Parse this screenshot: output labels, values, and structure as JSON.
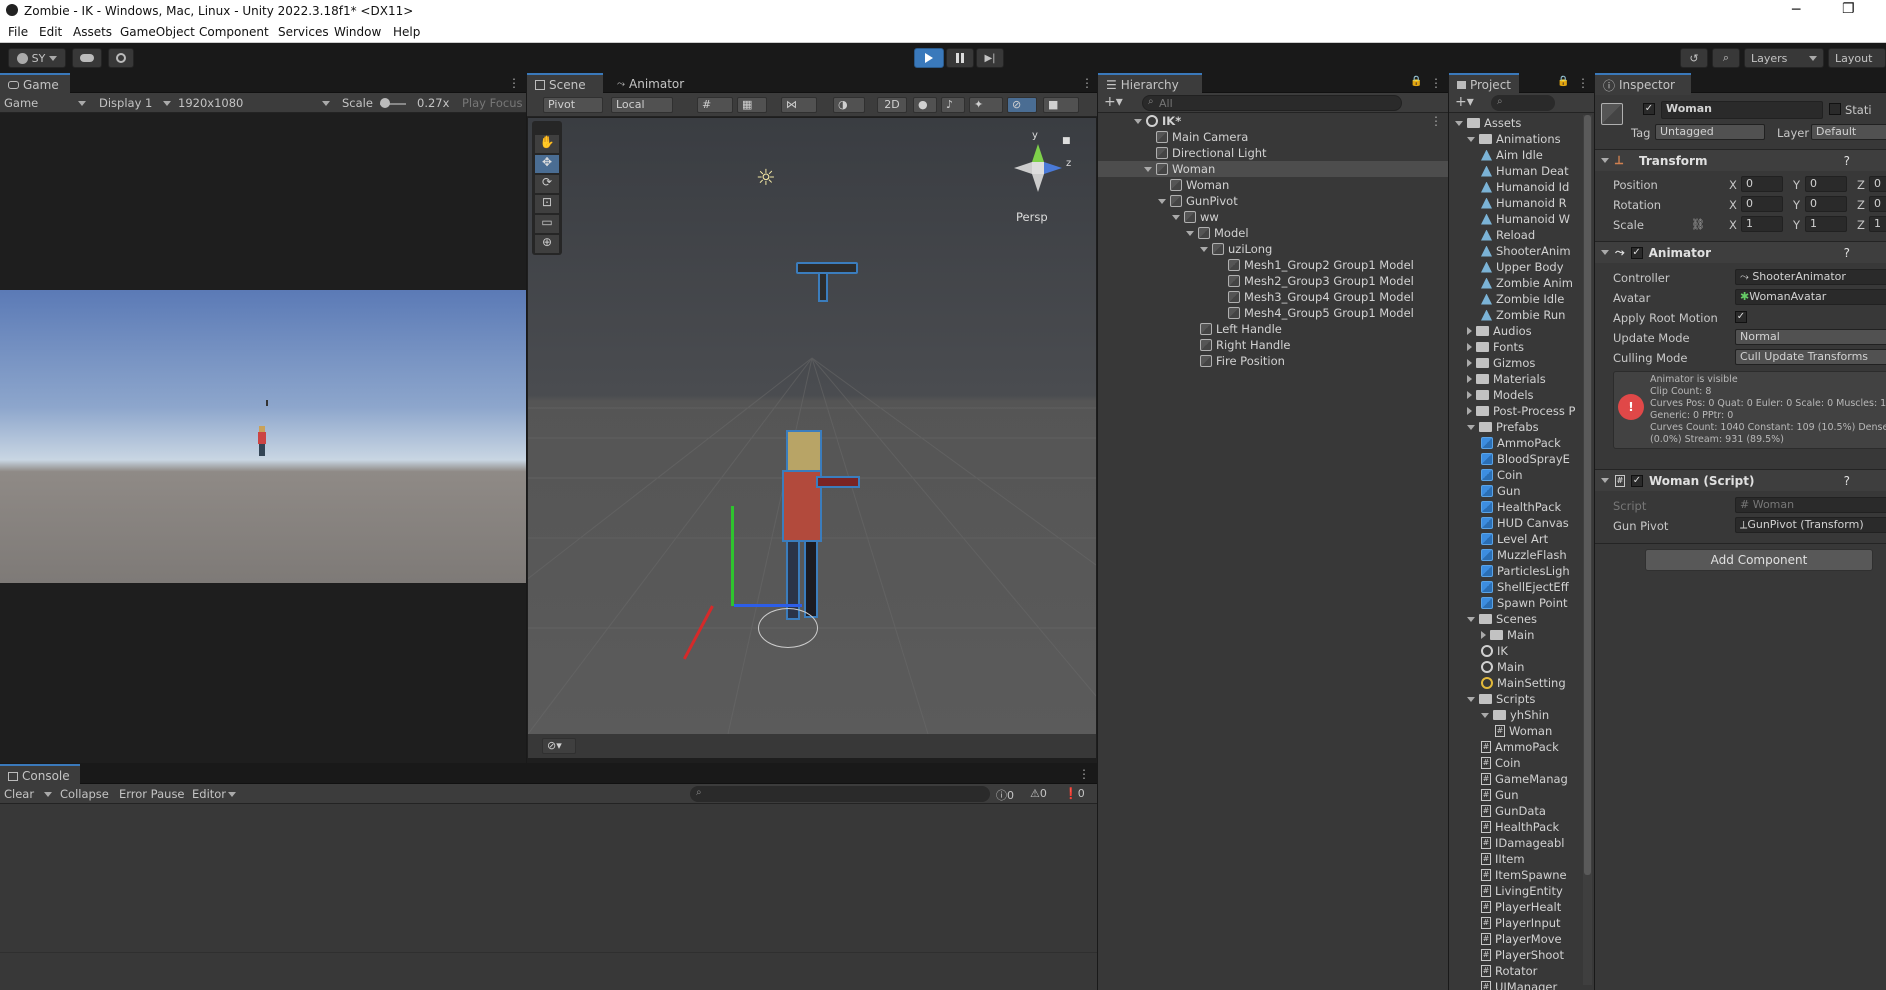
{
  "window": {
    "title": "Zombie - IK - Windows, Mac, Linux - Unity 2022.3.18f1* <DX11>"
  },
  "menu": [
    "File",
    "Edit",
    "Assets",
    "GameObject",
    "Component",
    "Services",
    "Window",
    "Help"
  ],
  "toolbar": {
    "account": "SY",
    "layers": "Layers",
    "layout": "Layout"
  },
  "game": {
    "tab": "Game",
    "mode": "Game",
    "display": "Display 1",
    "resolution": "1920x1080",
    "scale_label": "Scale",
    "scale_value": "0.27x",
    "play_focus": "Play Focus"
  },
  "scene": {
    "tab_scene": "Scene",
    "tab_animator": "Animator",
    "pivot": "Pivot",
    "local": "Local",
    "mode_2d": "2D",
    "persp": "Persp",
    "gizmo_y": "y",
    "gizmo_z": "z"
  },
  "hierarchy": {
    "tab": "Hierarchy",
    "search_placeholder": "All",
    "items": [
      {
        "label": "IK*",
        "bold": true
      },
      {
        "label": "Main Camera"
      },
      {
        "label": "Directional Light"
      },
      {
        "label": "Woman"
      },
      {
        "label": "Woman"
      },
      {
        "label": "GunPivot"
      },
      {
        "label": "ww"
      },
      {
        "label": "Model"
      },
      {
        "label": "uziLong"
      },
      {
        "label": "Mesh1_Group2 Group1 Model"
      },
      {
        "label": "Mesh2_Group3 Group1 Model"
      },
      {
        "label": "Mesh3_Group4 Group1 Model"
      },
      {
        "label": "Mesh4_Group5 Group1 Model"
      },
      {
        "label": "Left Handle"
      },
      {
        "label": "Right Handle"
      },
      {
        "label": "Fire Position"
      }
    ]
  },
  "project": {
    "tab": "Project",
    "items": [
      {
        "label": "Assets",
        "icon": "folder-icon"
      },
      {
        "label": "Animations",
        "icon": "folder-icon"
      },
      {
        "label": "Aim Idle",
        "icon": "animation-icon"
      },
      {
        "label": "Human Deat",
        "icon": "animation-icon"
      },
      {
        "label": "Humanoid Id",
        "icon": "animation-icon"
      },
      {
        "label": "Humanoid R",
        "icon": "animation-icon"
      },
      {
        "label": "Humanoid W",
        "icon": "animation-icon"
      },
      {
        "label": "Reload",
        "icon": "animation-icon"
      },
      {
        "label": "ShooterAnim",
        "icon": "animator-icon"
      },
      {
        "label": "Upper Body",
        "icon": "animation-icon"
      },
      {
        "label": "Zombie Anim",
        "icon": "animator-icon"
      },
      {
        "label": "Zombie Idle",
        "icon": "animation-icon"
      },
      {
        "label": "Zombie Run",
        "icon": "animation-icon"
      },
      {
        "label": "Audios",
        "icon": "folder-icon"
      },
      {
        "label": "Fonts",
        "icon": "folder-icon"
      },
      {
        "label": "Gizmos",
        "icon": "folder-icon"
      },
      {
        "label": "Materials",
        "icon": "folder-icon"
      },
      {
        "label": "Models",
        "icon": "folder-icon"
      },
      {
        "label": "Post-Process P",
        "icon": "folder-icon"
      },
      {
        "label": "Prefabs",
        "icon": "folder-icon"
      },
      {
        "label": "AmmoPack",
        "icon": "prefab-icon"
      },
      {
        "label": "BloodSprayE",
        "icon": "prefab-icon"
      },
      {
        "label": "Coin",
        "icon": "prefab-icon"
      },
      {
        "label": "Gun",
        "icon": "prefab-icon"
      },
      {
        "label": "HealthPack",
        "icon": "prefab-icon"
      },
      {
        "label": "HUD Canvas",
        "icon": "prefab-icon"
      },
      {
        "label": "Level Art",
        "icon": "prefab-icon"
      },
      {
        "label": "MuzzleFlash",
        "icon": "prefab-icon"
      },
      {
        "label": "ParticlesLigh",
        "icon": "prefab-icon"
      },
      {
        "label": "ShellEjectEff",
        "icon": "prefab-icon"
      },
      {
        "label": "Spawn Point",
        "icon": "prefab-icon"
      },
      {
        "label": "Scenes",
        "icon": "folder-icon"
      },
      {
        "label": "Main",
        "icon": "folder-icon"
      },
      {
        "label": "IK",
        "icon": "scene-icon"
      },
      {
        "label": "Main",
        "icon": "scene-icon"
      },
      {
        "label": "MainSetting",
        "icon": "settings-icon"
      },
      {
        "label": "Scripts",
        "icon": "folder-icon"
      },
      {
        "label": "yhShin",
        "icon": "folder-icon"
      },
      {
        "label": "Woman",
        "icon": "script-icon"
      },
      {
        "label": "AmmoPack",
        "icon": "script-icon"
      },
      {
        "label": "Coin",
        "icon": "script-icon"
      },
      {
        "label": "GameManag",
        "icon": "script-icon"
      },
      {
        "label": "Gun",
        "icon": "script-icon"
      },
      {
        "label": "GunData",
        "icon": "script-icon"
      },
      {
        "label": "HealthPack",
        "icon": "script-icon"
      },
      {
        "label": "IDamageabl",
        "icon": "script-icon"
      },
      {
        "label": "IItem",
        "icon": "script-icon"
      },
      {
        "label": "ItemSpawne",
        "icon": "script-icon"
      },
      {
        "label": "LivingEntity",
        "icon": "script-icon"
      },
      {
        "label": "PlayerHealt",
        "icon": "script-icon"
      },
      {
        "label": "PlayerInput",
        "icon": "script-icon"
      },
      {
        "label": "PlayerMove",
        "icon": "script-icon"
      },
      {
        "label": "PlayerShoot",
        "icon": "script-icon"
      },
      {
        "label": "Rotator",
        "icon": "script-icon"
      },
      {
        "label": "UIManager",
        "icon": "script-icon"
      }
    ]
  },
  "inspector": {
    "tab": "Inspector",
    "object_name": "Woman",
    "static_label": "Stati",
    "tag_label": "Tag",
    "tag_value": "Untagged",
    "layer_label": "Layer",
    "layer_value": "Default",
    "transform": {
      "title": "Transform",
      "position_label": "Position",
      "rotation_label": "Rotation",
      "scale_label": "Scale",
      "position": [
        "0",
        "0",
        "0"
      ],
      "rotation": [
        "0",
        "0",
        "0"
      ],
      "scale": [
        "1",
        "1",
        "1"
      ]
    },
    "animator": {
      "title": "Animator",
      "controller_label": "Controller",
      "controller_value": "ShooterAnimator",
      "avatar_label": "Avatar",
      "avatar_value": "WomanAvatar",
      "root_motion_label": "Apply Root Motion",
      "update_mode_label": "Update Mode",
      "update_mode_value": "Normal",
      "culling_label": "Culling Mode",
      "culling_value": "Cull Update Transforms",
      "info_lines": [
        "Animator is visible",
        "Clip Count: 8",
        "Curves Pos: 0 Quat: 0 Euler: 0 Scale: 0 Muscles: 1",
        "Generic: 0 PPtr: 0",
        "Curves Count: 1040 Constant: 109 (10.5%) Dense",
        "(0.0%) Stream: 931 (89.5%)"
      ]
    },
    "script": {
      "title": "Woman (Script)",
      "script_label": "Script",
      "script_value": "Woman",
      "gun_pivot_label": "Gun Pivot",
      "gun_pivot_value": "GunPivot (Transform)"
    },
    "add_component": "Add Component"
  },
  "console": {
    "tab": "Console",
    "clear": "Clear",
    "collapse": "Collapse",
    "error_pause": "Error Pause",
    "editor": "Editor",
    "log_count": "0",
    "warn_count": "0",
    "error_count": "0"
  }
}
